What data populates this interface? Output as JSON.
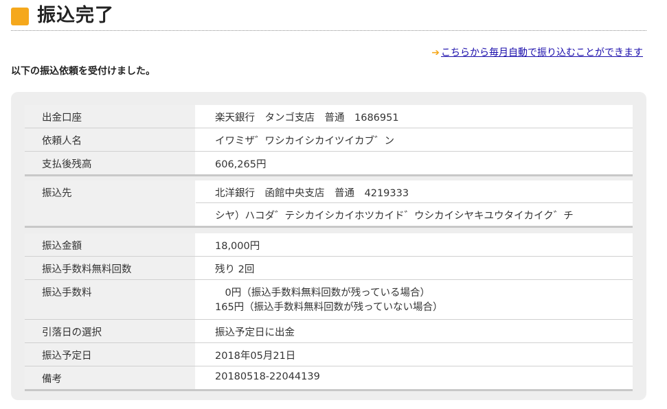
{
  "page": {
    "title": "振込完了",
    "monthly_link": {
      "arrow": "➔",
      "text": "こちらから毎月自動で振り込むことができます"
    },
    "intro": "以下の振込依頼を受付けました。"
  },
  "source_group": [
    {
      "label": "出金口座",
      "value": "楽天銀行　タンゴ支店　普通　1686951"
    },
    {
      "label": "依頼人名",
      "value": "イワミザ゛ワシカイシカイツイカブ゛ン"
    },
    {
      "label": "支払後残高",
      "value": "606,265円"
    }
  ],
  "destination_group": {
    "label": "振込先",
    "bank_line": "北洋銀行　函館中央支店　普通　4219333",
    "name_line": "シヤ）ハコダ゛テシカイシカイホツカイド゛ウシカイシヤキユウタイカイク゛チ"
  },
  "detail_group": [
    {
      "label": "振込金額",
      "lines": [
        "18,000円"
      ]
    },
    {
      "label": "振込手数料無料回数",
      "lines": [
        "残り 2回"
      ]
    },
    {
      "label": "振込手数料",
      "lines": [
        "　0円（振込手数料無料回数が残っている場合）",
        "165円（振込手数料無料回数が残っていない場合）"
      ]
    },
    {
      "label": "引落日の選択",
      "lines": [
        "振込予定日に出金"
      ]
    },
    {
      "label": "振込予定日",
      "lines": [
        "2018年05月21日"
      ]
    },
    {
      "label": "備考",
      "lines": [
        "20180518-22044139"
      ]
    }
  ],
  "colors": {
    "accent": "#f5a81c",
    "link": "#1a0dab",
    "panel": "#eeeeee",
    "label_bg": "#f0f0f0"
  }
}
